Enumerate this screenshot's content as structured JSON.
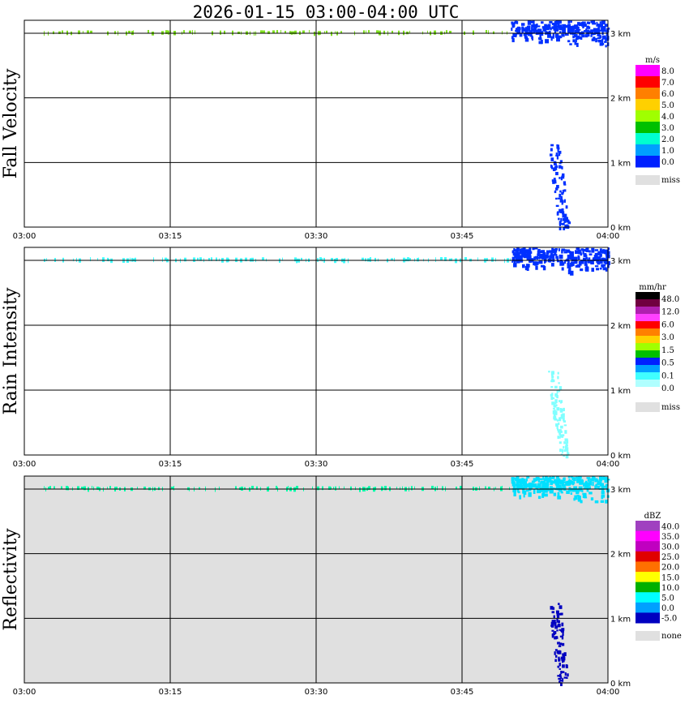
{
  "title": "2026-01-15  03:00-04:00 UTC",
  "time_ticks": [
    "03:00",
    "03:15",
    "03:30",
    "03:45",
    "04:00"
  ],
  "height_ticks": [
    "0 km",
    "1 km",
    "2 km",
    "3 km"
  ],
  "chart_data": [
    {
      "type": "heatmap",
      "title": "Fall Velocity",
      "ylabel": "Fall Velocity",
      "xlim": [
        "03:00",
        "04:00"
      ],
      "ylim_km": [
        0,
        3.2
      ],
      "background": "#ffffff",
      "colorbar": {
        "unit": "m/s",
        "labels": [
          "8.0",
          "7.0",
          "6.0",
          "5.0",
          "4.0",
          "3.0",
          "2.0",
          "1.0",
          "0.0"
        ],
        "colors": [
          "#ff00ff",
          "#ff0000",
          "#ff7f00",
          "#ffd000",
          "#a0ff00",
          "#00c000",
          "#00ffd0",
          "#00a0ff",
          "#0020ff"
        ],
        "missing_label": "miss",
        "missing_color": "#e0e0e0"
      },
      "layers": [
        {
          "name": "3 km band",
          "time_range": [
            "03:02",
            "03:50"
          ],
          "height_km": [
            3.0,
            3.05
          ],
          "dominant_color": "#80e020"
        },
        {
          "name": "upper cloud",
          "time_range": [
            "03:50",
            "04:00"
          ],
          "height_km": [
            2.75,
            3.2
          ],
          "dominant_color": "#0030ff"
        },
        {
          "name": "lower echo",
          "time_range": [
            "03:53",
            "03:56"
          ],
          "height_km": [
            0.0,
            1.3
          ],
          "dominant_color": "#0030ff"
        }
      ]
    },
    {
      "type": "heatmap",
      "title": "Rain Intensity",
      "ylabel": "Rain Intensity",
      "xlim": [
        "03:00",
        "04:00"
      ],
      "ylim_km": [
        0,
        3.2
      ],
      "background": "#ffffff",
      "colorbar": {
        "unit": "mm/hr",
        "labels": [
          "48.0",
          "12.0",
          "6.0",
          "3.0",
          "1.5",
          "0.5",
          "0.1",
          "0.0"
        ],
        "colors": [
          "#000000",
          "#700040",
          "#b020b0",
          "#ff40ff",
          "#ff0000",
          "#ff8000",
          "#ffd000",
          "#a0ff00",
          "#00c000",
          "#0020ff",
          "#00a0ff",
          "#40ffff",
          "#b0ffff",
          "#ffffff"
        ],
        "missing_label": "miss",
        "missing_color": "#e0e0e0"
      },
      "layers": [
        {
          "name": "3 km band",
          "time_range": [
            "03:02",
            "03:50"
          ],
          "height_km": [
            3.0,
            3.05
          ],
          "dominant_color": "#40ffff"
        },
        {
          "name": "upper cloud",
          "time_range": [
            "03:50",
            "04:00"
          ],
          "height_km": [
            2.75,
            3.2
          ],
          "dominant_color": "#0030ff"
        },
        {
          "name": "lower echo",
          "time_range": [
            "03:53",
            "03:56"
          ],
          "height_km": [
            0.0,
            1.3
          ],
          "dominant_color": "#80ffff"
        }
      ]
    },
    {
      "type": "heatmap",
      "title": "Reflectivity",
      "ylabel": "Reflectivity",
      "xlim": [
        "03:00",
        "04:00"
      ],
      "ylim_km": [
        0,
        3.2
      ],
      "background": "#e0e0e0",
      "colorbar": {
        "unit": "dBZ",
        "labels": [
          "40.0",
          "35.0",
          "30.0",
          "25.0",
          "20.0",
          "15.0",
          "10.0",
          "5.0",
          "0.0",
          "-5.0"
        ],
        "colors": [
          "#a040c0",
          "#ff00ff",
          "#c000c0",
          "#e00000",
          "#ff7000",
          "#ffff00",
          "#00b000",
          "#00ffff",
          "#00a0ff",
          "#0000c0"
        ],
        "missing_label": "none",
        "missing_color": "#e0e0e0"
      },
      "layers": [
        {
          "name": "3 km band",
          "time_range": [
            "03:02",
            "03:50"
          ],
          "height_km": [
            3.0,
            3.05
          ],
          "dominant_color": "#00ffaa"
        },
        {
          "name": "upper cloud",
          "time_range": [
            "03:50",
            "04:00"
          ],
          "height_km": [
            2.75,
            3.2
          ],
          "dominant_color": "#00e0ff"
        },
        {
          "name": "lower echo",
          "time_range": [
            "03:53",
            "03:56"
          ],
          "height_km": [
            0.0,
            1.3
          ],
          "dominant_color": "#0000c0"
        }
      ]
    }
  ]
}
